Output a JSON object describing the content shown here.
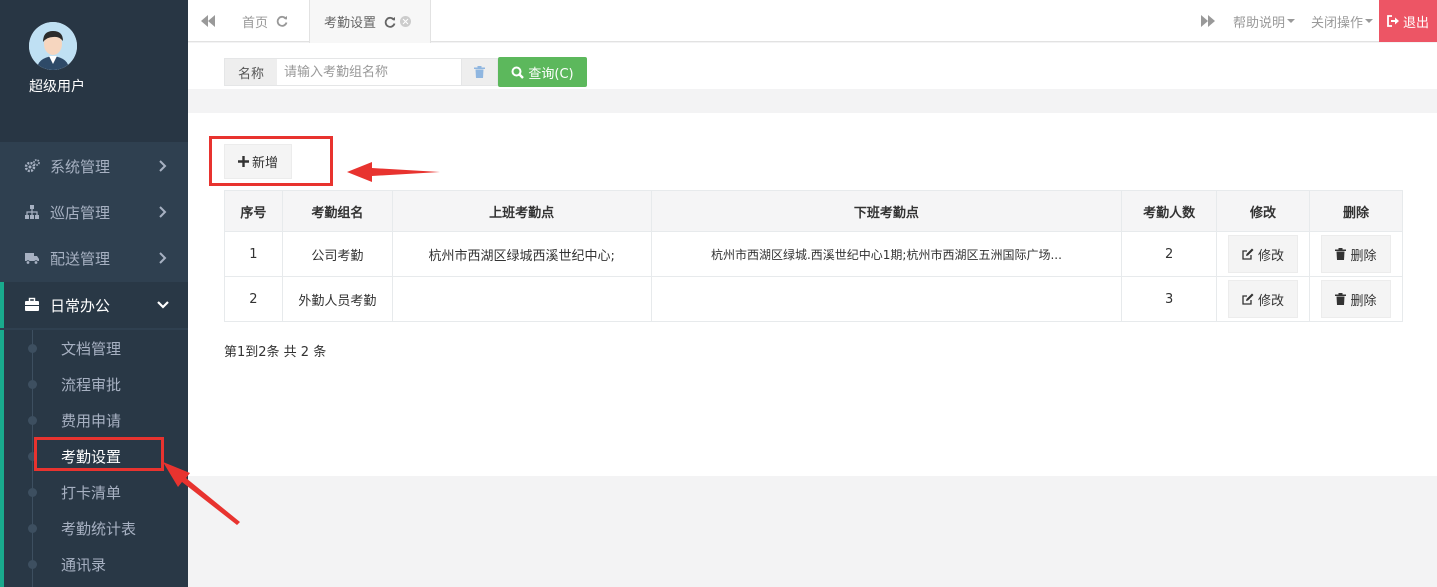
{
  "user": {
    "name": "超级用户"
  },
  "sidebar": {
    "menus": [
      {
        "label": "系统管理",
        "icon": "gears-icon"
      },
      {
        "label": "巡店管理",
        "icon": "sitemap-icon"
      },
      {
        "label": "配送管理",
        "icon": "truck-icon"
      },
      {
        "label": "日常办公",
        "icon": "briefcase-icon"
      }
    ],
    "submenu": [
      {
        "label": "文档管理"
      },
      {
        "label": "流程审批"
      },
      {
        "label": "费用申请"
      },
      {
        "label": "考勤设置"
      },
      {
        "label": "打卡清单"
      },
      {
        "label": "考勤统计表"
      },
      {
        "label": "通讯录"
      }
    ]
  },
  "tabs": {
    "home": "首页",
    "current": "考勤设置",
    "help": "帮助说明",
    "close_ops": "关闭操作",
    "logout": "退出"
  },
  "search": {
    "label": "名称",
    "placeholder": "请输入考勤组名称",
    "query_label": "查询(C)"
  },
  "toolbar": {
    "add_label": "新增"
  },
  "table": {
    "headers": [
      "序号",
      "考勤组名",
      "上班考勤点",
      "下班考勤点",
      "考勤人数",
      "修改",
      "删除"
    ],
    "rows": [
      {
        "no": "1",
        "name": "公司考勤",
        "on_duty": "杭州市西湖区绿城西溪世纪中心;",
        "off_duty": "杭州市西湖区绿城.西溪世纪中心1期;杭州市西湖区五洲国际广场...",
        "count": "2",
        "edit": "修改",
        "delete": "删除"
      },
      {
        "no": "2",
        "name": "外勤人员考勤",
        "on_duty": "",
        "off_duty": "",
        "count": "3",
        "edit": "修改",
        "delete": "删除"
      }
    ]
  },
  "pager": {
    "text": "第1到2条 共 2 条"
  },
  "colors": {
    "sidebar": "#2f4050",
    "accent": "#19aa8d",
    "query": "#5cb85c",
    "logout": "#ed5565",
    "highlight": "#e8332f"
  }
}
